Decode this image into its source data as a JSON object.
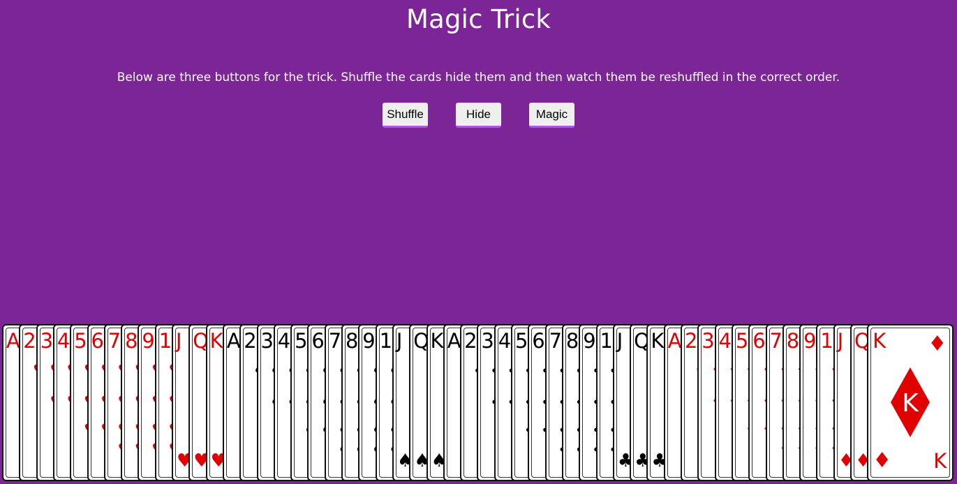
{
  "page": {
    "title": "Magic Trick",
    "instructions": "Below are three buttons for the trick. Shuffle the cards hide them and then watch them be reshuffled in the correct order."
  },
  "buttons": {
    "shuffle": "Shuffle",
    "hide": "Hide",
    "magic": "Magic"
  },
  "colors": {
    "background": "#7b2596",
    "button_accent": "#b154e3",
    "red_suit": "#e00000",
    "black_suit": "#000000"
  },
  "deck": {
    "cards": [
      {
        "rank": "A",
        "suit": "hearts"
      },
      {
        "rank": "2",
        "suit": "hearts"
      },
      {
        "rank": "3",
        "suit": "hearts"
      },
      {
        "rank": "4",
        "suit": "hearts"
      },
      {
        "rank": "5",
        "suit": "hearts"
      },
      {
        "rank": "6",
        "suit": "hearts"
      },
      {
        "rank": "7",
        "suit": "hearts"
      },
      {
        "rank": "8",
        "suit": "hearts"
      },
      {
        "rank": "9",
        "suit": "hearts"
      },
      {
        "rank": "10",
        "suit": "hearts"
      },
      {
        "rank": "J",
        "suit": "hearts"
      },
      {
        "rank": "Q",
        "suit": "hearts"
      },
      {
        "rank": "K",
        "suit": "hearts"
      },
      {
        "rank": "A",
        "suit": "spades"
      },
      {
        "rank": "2",
        "suit": "spades"
      },
      {
        "rank": "3",
        "suit": "spades"
      },
      {
        "rank": "4",
        "suit": "spades"
      },
      {
        "rank": "5",
        "suit": "spades"
      },
      {
        "rank": "6",
        "suit": "spades"
      },
      {
        "rank": "7",
        "suit": "spades"
      },
      {
        "rank": "8",
        "suit": "spades"
      },
      {
        "rank": "9",
        "suit": "spades"
      },
      {
        "rank": "10",
        "suit": "spades"
      },
      {
        "rank": "J",
        "suit": "spades"
      },
      {
        "rank": "Q",
        "suit": "spades"
      },
      {
        "rank": "K",
        "suit": "spades"
      },
      {
        "rank": "A",
        "suit": "clubs"
      },
      {
        "rank": "2",
        "suit": "clubs"
      },
      {
        "rank": "3",
        "suit": "clubs"
      },
      {
        "rank": "4",
        "suit": "clubs"
      },
      {
        "rank": "5",
        "suit": "clubs"
      },
      {
        "rank": "6",
        "suit": "clubs"
      },
      {
        "rank": "7",
        "suit": "clubs"
      },
      {
        "rank": "8",
        "suit": "clubs"
      },
      {
        "rank": "9",
        "suit": "clubs"
      },
      {
        "rank": "10",
        "suit": "clubs"
      },
      {
        "rank": "J",
        "suit": "clubs"
      },
      {
        "rank": "Q",
        "suit": "clubs"
      },
      {
        "rank": "K",
        "suit": "clubs"
      },
      {
        "rank": "A",
        "suit": "diamonds"
      },
      {
        "rank": "2",
        "suit": "diamonds"
      },
      {
        "rank": "3",
        "suit": "diamonds"
      },
      {
        "rank": "4",
        "suit": "diamonds"
      },
      {
        "rank": "5",
        "suit": "diamonds"
      },
      {
        "rank": "6",
        "suit": "diamonds"
      },
      {
        "rank": "7",
        "suit": "diamonds"
      },
      {
        "rank": "8",
        "suit": "diamonds"
      },
      {
        "rank": "9",
        "suit": "diamonds"
      },
      {
        "rank": "10",
        "suit": "diamonds"
      },
      {
        "rank": "J",
        "suit": "diamonds"
      },
      {
        "rank": "Q",
        "suit": "diamonds"
      },
      {
        "rank": "K",
        "suit": "diamonds"
      }
    ]
  }
}
